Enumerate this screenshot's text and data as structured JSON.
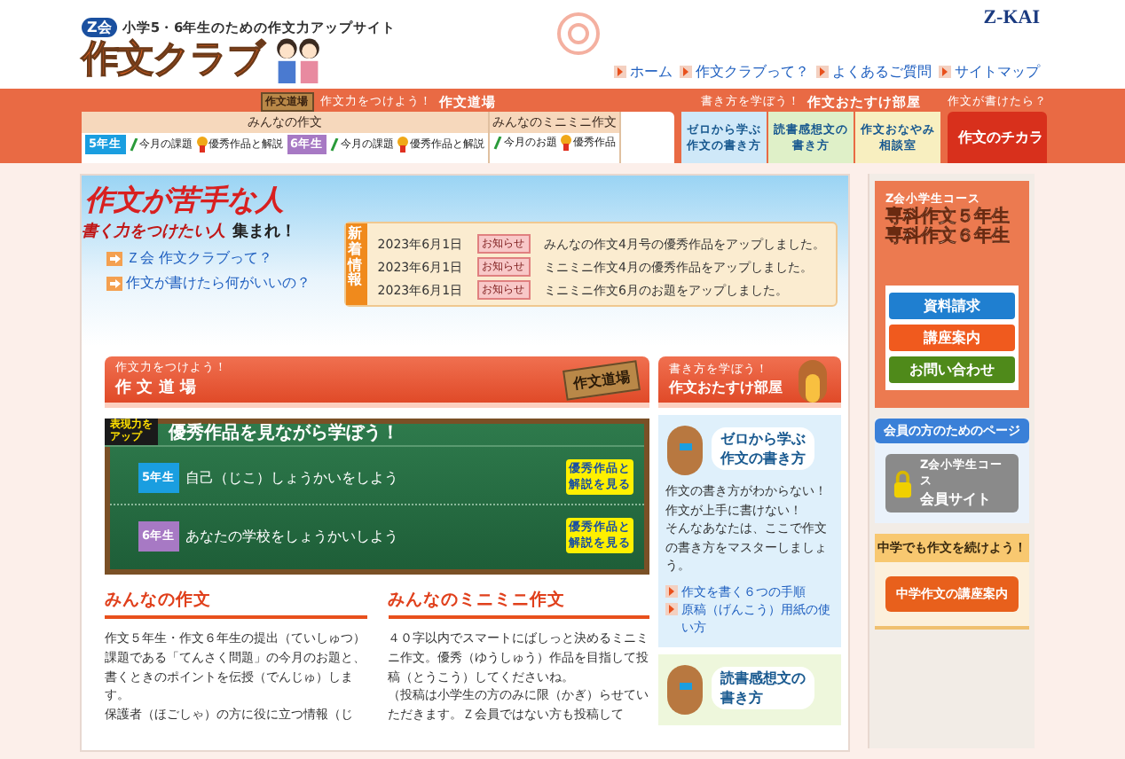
{
  "header": {
    "tagline": "小学5・6年生のための作文力アップサイト",
    "logo_badge": "Z会",
    "logo": "作文クラブ",
    "brand": "Z-KAI",
    "links": [
      "ホーム",
      "作文クラブって？",
      "よくあるご質問",
      "サイトマップ"
    ]
  },
  "nav": {
    "dojo": {
      "badge": "作文道場",
      "caption": "作文力をつけよう！",
      "title": "作文道場",
      "groups": [
        {
          "title": "みんなの作文",
          "items": [
            {
              "kind": "grade",
              "label": "5年生",
              "color": "#1a9ee0"
            },
            {
              "kind": "pencil",
              "label": "今月の課題"
            },
            {
              "kind": "medal",
              "label": "優秀作品と解説"
            },
            {
              "kind": "grade",
              "label": "6年生",
              "color": "#a779c4"
            },
            {
              "kind": "pencil",
              "label": "今月の課題"
            },
            {
              "kind": "medal",
              "label": "優秀作品と解説"
            }
          ]
        },
        {
          "title": "みんなのミニミニ作文",
          "items": [
            {
              "kind": "pencil",
              "label": "今月のお題"
            },
            {
              "kind": "medal",
              "label": "優秀作品"
            }
          ]
        }
      ]
    },
    "otasuke": {
      "caption": "書き方を学ぼう！",
      "title": "作文おたすけ部屋",
      "items": [
        {
          "label": "ゼロから学ぶ作文の書き方",
          "color": "#cfe8f8"
        },
        {
          "label": "読書感想文の書き方",
          "color": "#dff0c8"
        },
        {
          "label": "作文おなやみ相談室",
          "color": "#f8efc0"
        }
      ]
    },
    "chikara": {
      "caption": "作文が書けたら？",
      "title": "作文のチカラ"
    }
  },
  "hero": {
    "headline": "作文が苦手な人",
    "subline": "書く力をつけたい人",
    "shout": "集まれ！",
    "links": [
      "Ｚ会 作文クラブって？",
      "作文が書けたら何がいいの？"
    ]
  },
  "news": {
    "label": "新着情報",
    "items": [
      {
        "date": "2023年6月1日",
        "tag": "お知らせ",
        "text": "みんなの作文4月号の優秀作品をアップしました。"
      },
      {
        "date": "2023年6月1日",
        "tag": "お知らせ",
        "text": "ミニミニ作文4月の優秀作品をアップしました。"
      },
      {
        "date": "2023年6月1日",
        "tag": "お知らせ",
        "text": "ミニミニ作文6月のお題をアップしました。"
      }
    ]
  },
  "dojo": {
    "caption": "作文力をつけよう！",
    "title": "作 文 道 場",
    "badge": "作文道場",
    "board": {
      "sticker_top": "表現力を",
      "sticker": "アップ",
      "title": "優秀作品を見ながら学ぼう！",
      "rows": [
        {
          "grade": "5年生",
          "color": "#1a9ee0",
          "topic": "自己（じこ）しょうかいをしよう",
          "button": "優秀作品と解説を見る"
        },
        {
          "grade": "6年生",
          "color": "#a779c4",
          "topic": "あなたの学校をしょうかいしよう",
          "button": "優秀作品と解説を見る"
        }
      ]
    }
  },
  "sections": [
    {
      "title": "みんなの作文",
      "paragraphs": [
        "作文５年生・作文６年生の提出（ていしゅつ）課題である「てんさく問題」の今月のお題と、書くときのポイントを伝授（でんじゅ）します。",
        "保護者（ほごしゃ）の方に役に立つ情報（じ"
      ]
    },
    {
      "title": "みんなのミニミニ作文",
      "paragraphs": [
        "４０字以内でスマートにばしっと決めるミニミニ作文。優秀（ゆうしゅう）作品を目指して投稿（とうこう）してくださいね。",
        "（投稿は小学生の方のみに限（かぎ）らせていただきます。Ｚ会員ではない方も投稿して"
      ]
    }
  ],
  "otasuke_panel": {
    "caption": "書き方を学ぼう！",
    "title": "作文おたすけ部屋",
    "cards": [
      {
        "title_small": "ゼロから学ぶ",
        "title": "作文の書き方",
        "color": "#dff0fb",
        "text": [
          "作文の書き方がわからない！作文が上手に書けない！",
          "そんなあなたは、ここで作文の書き方をマスターしましょう。"
        ],
        "links": [
          "作文を書く６つの手順",
          "原稿（げんこう）用紙の使い方"
        ]
      },
      {
        "title_small": "読書感想文の",
        "title": "書き方",
        "color": "#eef7dc"
      }
    ]
  },
  "sidebar": {
    "course": {
      "small": "Z会小学生コース",
      "titles": [
        "専科作文５年生",
        "専科作文６年生"
      ],
      "buttons": [
        {
          "label": "資料請求",
          "color": "#1f7fd0"
        },
        {
          "label": "講座案内",
          "color": "#f05a1e"
        },
        {
          "label": "お問い合わせ",
          "color": "#4f8a1a"
        }
      ]
    },
    "member": {
      "title": "会員の方のためのページ",
      "small": "Z会小学生コース",
      "button": "会員サイト"
    },
    "junior": {
      "title": "中学でも作文を続けよう！",
      "button": "中学作文の講座案内"
    }
  }
}
